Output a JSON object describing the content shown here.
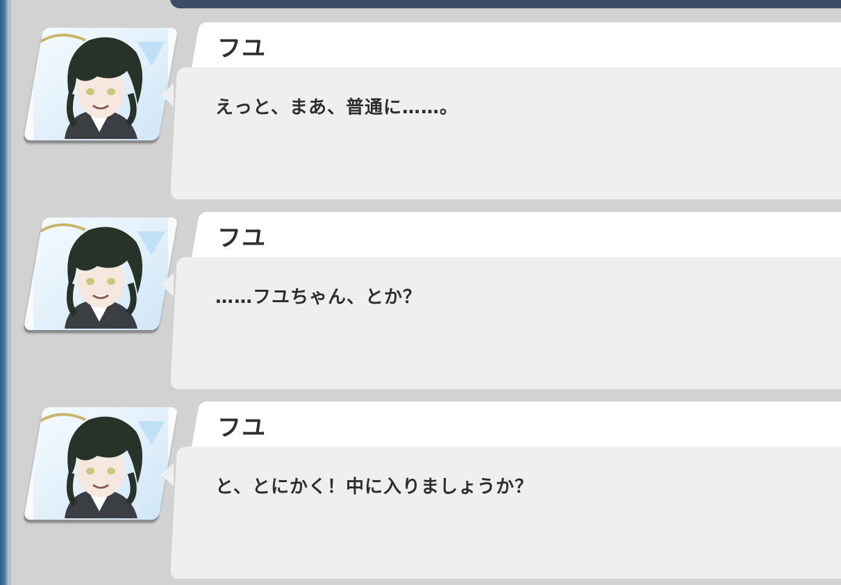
{
  "messages": [
    {
      "speaker": "フユ",
      "text": "えっと、まあ、普通に……。"
    },
    {
      "speaker": "フユ",
      "text": "……フユちゃん、とか？"
    },
    {
      "speaker": "フユ",
      "text": "と、とにかく！中に入りましょうか？"
    }
  ],
  "colors": {
    "background": "#d2d2d2",
    "top_bar": "#3b4c66",
    "name_tab": "#ffffff",
    "bubble": "#efefef",
    "text": "#2e2e2e"
  },
  "icons": {
    "avatar": "character-portrait-icon"
  }
}
